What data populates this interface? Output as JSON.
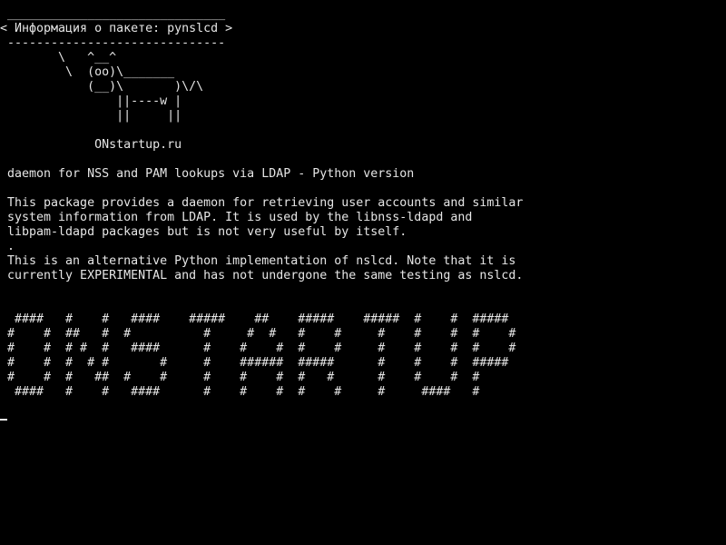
{
  "theme": {
    "background": "#000000",
    "foreground": "#e6e6e6"
  },
  "terminal": {
    "lines": [
      " ______________________________",
      "< Информация о пакете: pynslcd >",
      " ------------------------------",
      "        \\   ^__^",
      "         \\  (oo)\\_______",
      "            (__)\\       )\\/\\",
      "                ||----w |",
      "                ||     ||",
      "",
      "             ONstartup.ru",
      "",
      " daemon for NSS and PAM lookups via LDAP - Python version",
      "",
      " This package provides a daemon for retrieving user accounts and similar",
      " system information from LDAP. It is used by the libnss-ldapd and",
      " libpam-ldapd packages but is not very useful by itself.",
      " .",
      " This is an alternative Python implementation of nslcd. Note that it is",
      " currently EXPERIMENTAL and has not undergone the same testing as nslcd.",
      "",
      "",
      "  ####   #    #   ####    #####    ##    #####    #####  #    #  #####",
      " #    #  ##   #  #          #     #  #   #    #     #    #    #  #    #",
      " #    #  # #  #   ####      #    #    #  #    #     #    #    #  #    #",
      " #    #  #  # #       #     #    ######  #####      #    #    #  #####",
      " #    #  #   ##  #    #     #    #    #  #   #      #    #    #  #",
      "  ####   #    #   ####      #    #    #  #    #     #     ####   #"
    ]
  }
}
